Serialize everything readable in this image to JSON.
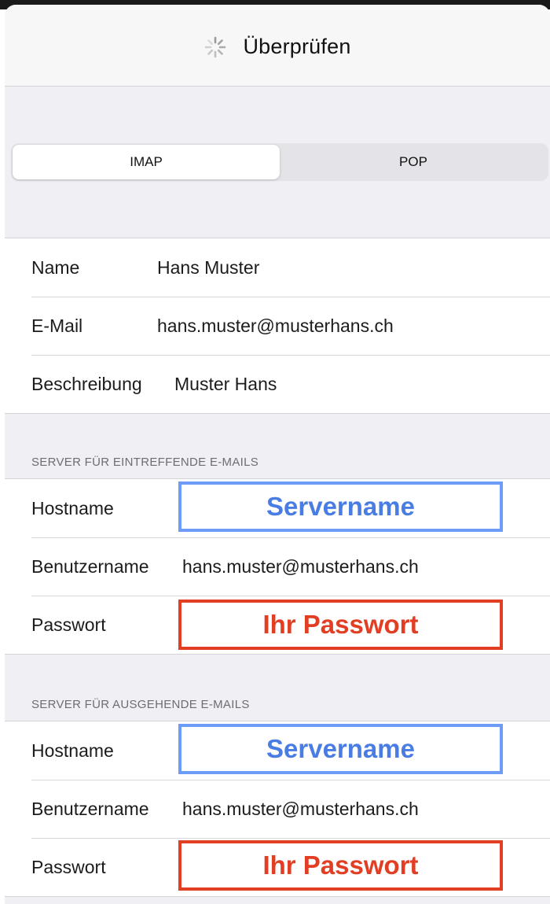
{
  "nav": {
    "title": "Überprüfen",
    "spinner_icon": "activity-spinner-icon"
  },
  "segmented": {
    "options": [
      "IMAP",
      "POP"
    ],
    "selected": "IMAP"
  },
  "account": {
    "name_label": "Name",
    "name_value": "Hans Muster",
    "email_label": "E-Mail",
    "email_value": "hans.muster@musterhans.ch",
    "description_label": "Beschreibung",
    "description_value": "Muster Hans"
  },
  "incoming": {
    "header": "SERVER FÜR EINTREFFENDE E-MAILS",
    "hostname_label": "Hostname",
    "hostname_value": "Servername",
    "username_label": "Benutzername",
    "username_value": "hans.muster@musterhans.ch",
    "password_label": "Passwort",
    "password_value": "Ihr Passwort"
  },
  "outgoing": {
    "header": "SERVER FÜR AUSGEHENDE E-MAILS",
    "hostname_label": "Hostname",
    "hostname_value": "Servername",
    "username_label": "Benutzername",
    "username_value": "hans.muster@musterhans.ch",
    "password_label": "Passwort",
    "password_value": "Ihr Passwort"
  },
  "colors": {
    "highlight_blue": "#6d9cf7",
    "highlight_red": "#e23e23",
    "background": "#efeff4"
  }
}
